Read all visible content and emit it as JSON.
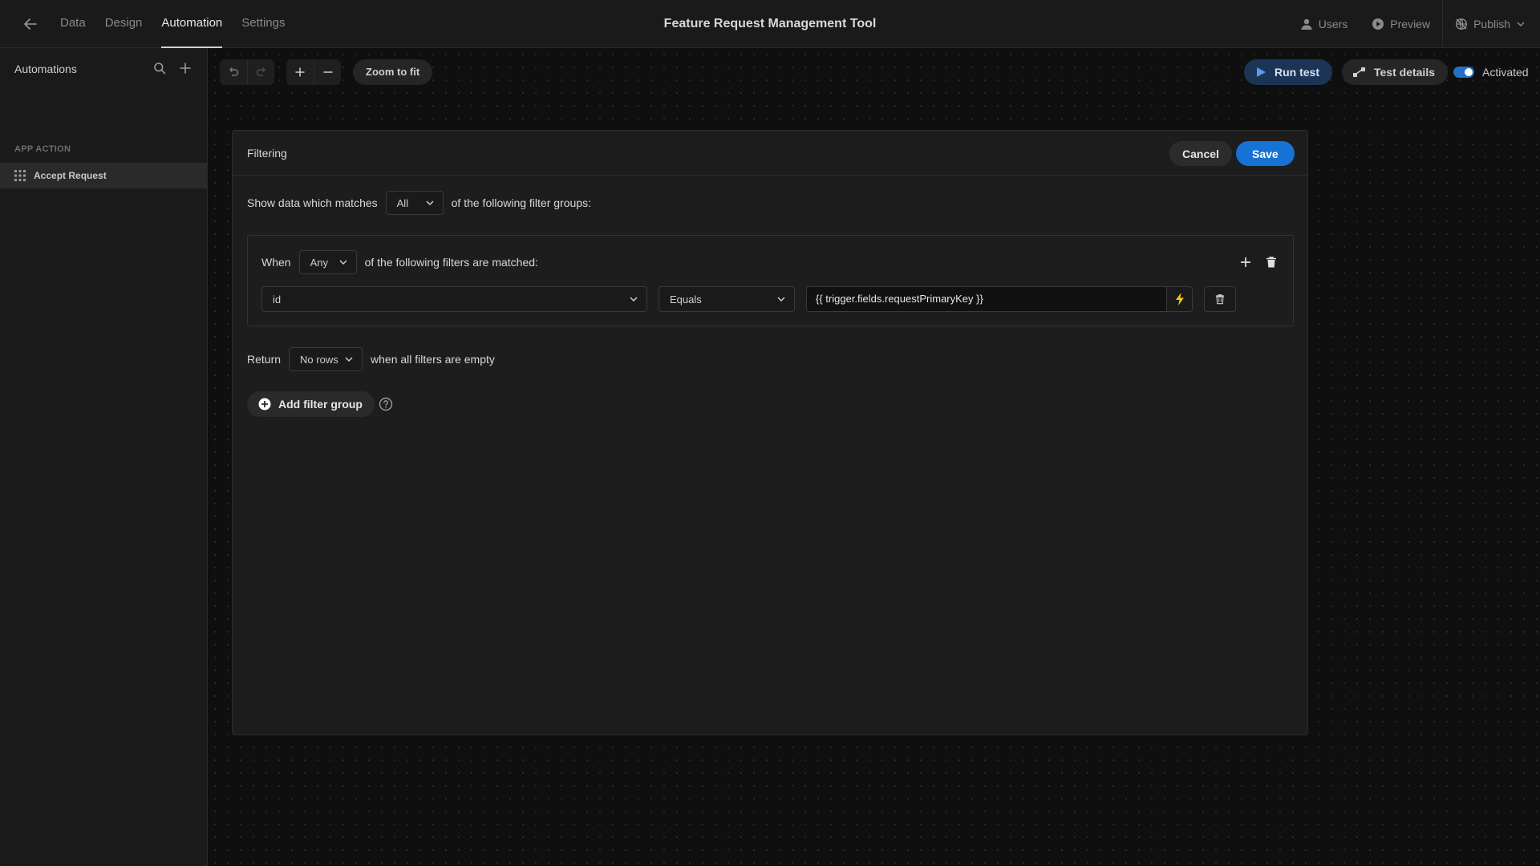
{
  "header": {
    "tabs": [
      {
        "label": "Data"
      },
      {
        "label": "Design"
      },
      {
        "label": "Automation"
      },
      {
        "label": "Settings"
      }
    ],
    "active_tab": "Automation",
    "app_title": "Feature Request Management Tool",
    "users_label": "Users",
    "preview_label": "Preview",
    "publish_label": "Publish"
  },
  "sidebar": {
    "title": "Automations",
    "section_label": "APP ACTION",
    "items": [
      {
        "label": "Accept Request"
      }
    ]
  },
  "toolbar": {
    "zoom_fit_label": "Zoom to fit",
    "run_test_label": "Run test",
    "test_details_label": "Test details",
    "activated_label": "Activated",
    "activated": true
  },
  "modal": {
    "title": "Filtering",
    "cancel_label": "Cancel",
    "save_label": "Save",
    "match_prefix": "Show data which matches",
    "match_value": "All",
    "match_suffix": "of the following filter groups:",
    "group": {
      "when_label": "When",
      "when_value": "Any",
      "when_suffix": "of the following filters are matched:",
      "filter": {
        "field": "id",
        "operator": "Equals",
        "value": "{{ trigger.fields.requestPrimaryKey }}"
      }
    },
    "return_label": "Return",
    "return_value": "No rows",
    "return_suffix": "when all filters are empty",
    "add_group_label": "Add filter group"
  },
  "colors": {
    "accent": "#1672d4",
    "bolt": "#f5c518",
    "background": "#0d0d0d"
  }
}
